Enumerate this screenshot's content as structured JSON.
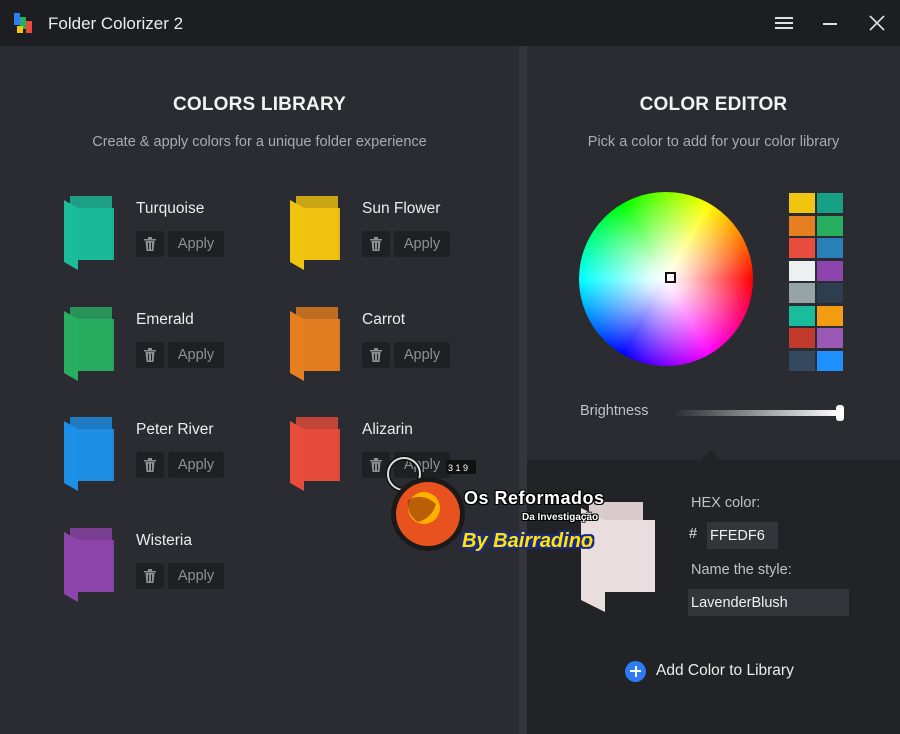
{
  "window": {
    "title": "Folder Colorizer 2"
  },
  "library": {
    "title": "COLORS LIBRARY",
    "subtitle": "Create & apply colors for a unique folder experience",
    "apply_label": "Apply",
    "items": [
      {
        "name": "Turquoise",
        "color": "#1abc9c"
      },
      {
        "name": "Sun Flower",
        "color": "#f1c40f"
      },
      {
        "name": "Emerald",
        "color": "#27ae60"
      },
      {
        "name": "Carrot",
        "color": "#e67e22"
      },
      {
        "name": "Peter River",
        "color": "#1e8fe6"
      },
      {
        "name": "Alizarin",
        "color": "#e74c3c"
      },
      {
        "name": "Wisteria",
        "color": "#8e44ad"
      }
    ]
  },
  "editor": {
    "title": "COLOR EDITOR",
    "subtitle": "Pick a color to add for your color library",
    "brightness_label": "Brightness",
    "brightness_value": 1.0,
    "swatches": [
      [
        "#f1c40f",
        "#16a085"
      ],
      [
        "#e67e22",
        "#27ae60"
      ],
      [
        "#e74c3c",
        "#2980b9"
      ],
      [
        "#ecf0f1",
        "#8e44ad"
      ],
      [
        "#95a5a6",
        "#2c3e50"
      ],
      [
        "#1abc9c",
        "#f39c12"
      ],
      [
        "#c0392b",
        "#9b59b6"
      ],
      [
        "#34495e",
        "#1e90ff"
      ]
    ],
    "hex_label": "HEX color:",
    "hash": "#",
    "hex_value": "FFEDF6",
    "name_label": "Name the style:",
    "name_value": "LavenderBlush",
    "preview_color": "#eaddde",
    "add_label": "Add Color to Library"
  },
  "watermark": {
    "line1": "Os Reformados",
    "line2": "Da Investigação",
    "line3": "By Bairradino"
  }
}
